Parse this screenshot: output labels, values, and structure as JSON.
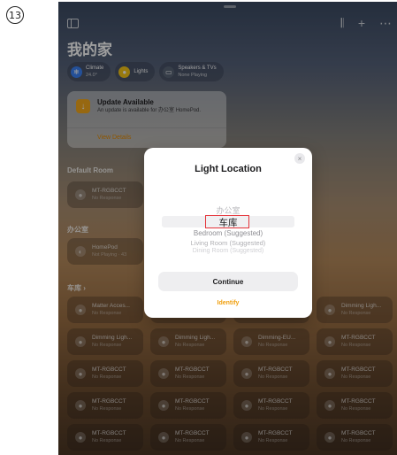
{
  "step": "13",
  "home": {
    "title": "我的家",
    "chips": [
      {
        "title": "Climate",
        "sub": "24.0°",
        "color": "#3b82f6"
      },
      {
        "title": "Lights",
        "sub": "",
        "color": "#f5c518"
      },
      {
        "title": "Speakers & TVs",
        "sub": "None Playing",
        "color": "#5a6577"
      }
    ],
    "update": {
      "title": "Update Available",
      "body": "An update is available for 办公室 HomePod.",
      "link": "View Details"
    },
    "sections": {
      "default_room": "Default Room",
      "office": "办公室",
      "garage": "车库 ›"
    },
    "tiles": {
      "default_room": [
        {
          "name": "MT-RGBCCT",
          "status": "No Response"
        }
      ],
      "office": [
        {
          "name": "HomePod",
          "status": "Not Playing · 43"
        }
      ],
      "garage": [
        {
          "name": "Matter Acces...",
          "status": "No Response"
        },
        {
          "name": "",
          "status": ""
        },
        {
          "name": "",
          "status": ""
        },
        {
          "name": "Dimming Ligh...",
          "status": "No Response"
        },
        {
          "name": "Dimming Ligh...",
          "status": "No Response"
        },
        {
          "name": "Dimming Ligh...",
          "status": "No Response"
        },
        {
          "name": "Dimming-EU...",
          "status": "No Response"
        },
        {
          "name": "MT-RGBCCT",
          "status": "No Response"
        },
        {
          "name": "MT-RGBCCT",
          "status": "No Response"
        },
        {
          "name": "MT-RGBCCT",
          "status": "No Response"
        },
        {
          "name": "MT-RGBCCT",
          "status": "No Response"
        },
        {
          "name": "MT-RGBCCT",
          "status": "No Response"
        },
        {
          "name": "MT-RGBCCT",
          "status": "No Response"
        },
        {
          "name": "MT-RGBCCT",
          "status": "No Response"
        },
        {
          "name": "MT-RGBCCT",
          "status": "No Response"
        },
        {
          "name": "MT-RGBCCT",
          "status": "No Response"
        },
        {
          "name": "MT-RGBCCT",
          "status": "No Response"
        },
        {
          "name": "MT-RGBCCT",
          "status": "No Response"
        },
        {
          "name": "MT-RGBCCT",
          "status": "No Response"
        },
        {
          "name": "MT-RGBCCT",
          "status": "No Response"
        }
      ]
    }
  },
  "modal": {
    "title": "Light Location",
    "close": "×",
    "options": [
      {
        "label": "办公室",
        "state": "above"
      },
      {
        "label": "车库",
        "state": "selected"
      },
      {
        "label": "Bedroom (Suggested)",
        "state": "below1"
      },
      {
        "label": "Living Room (Suggested)",
        "state": "below2"
      },
      {
        "label": "Dining Room (Suggested)",
        "state": "below3"
      }
    ],
    "continue_label": "Continue",
    "identify_label": "Identify"
  },
  "colors": {
    "accent": "#f0a010",
    "highlight_box": "#e4343a"
  }
}
